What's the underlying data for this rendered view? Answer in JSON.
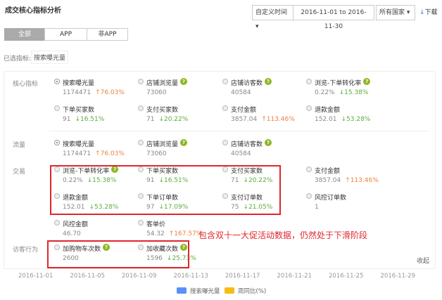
{
  "header": {
    "title": "成交核心指标分析",
    "time_select": "自定义时间",
    "date_range": "2016-11-01 to 2016-11-30",
    "country_select": "所有国家",
    "download": "下载"
  },
  "tabs": [
    {
      "label": "全部",
      "active": true
    },
    {
      "label": "APP"
    },
    {
      "label": "非APP"
    }
  ],
  "selected": {
    "label": "已选指标:",
    "chip": "搜索曝光量"
  },
  "sections": [
    {
      "name": "核心指标",
      "metrics": [
        {
          "label": "搜索曝光量",
          "value": "1174471",
          "change": "↑76.03%",
          "dir": "up",
          "checked": true
        },
        {
          "label": "店铺浏览量",
          "value": "73060",
          "help": true
        },
        {
          "label": "店铺访客数",
          "value": "40584",
          "help": true
        },
        {
          "label": "浏览-下单转化率",
          "value": "0.22%",
          "change": "↓15.38%",
          "dir": "down",
          "help": true
        },
        {
          "label": "下单买家数",
          "value": "91",
          "change": "↓16.51%",
          "dir": "down"
        },
        {
          "label": "支付买家数",
          "value": "71",
          "change": "↓20.22%",
          "dir": "down"
        },
        {
          "label": "支付金额",
          "value": "3857.04",
          "change": "↑113.46%",
          "dir": "up"
        },
        {
          "label": "退款金额",
          "value": "152.01",
          "change": "↓53.28%",
          "dir": "down"
        }
      ]
    },
    {
      "name": "流量",
      "metrics": [
        {
          "label": "搜索曝光量",
          "value": "1174471",
          "change": "↑76.03%",
          "dir": "up",
          "checked": true
        },
        {
          "label": "店铺浏览量",
          "value": "73060",
          "help": true
        },
        {
          "label": "店铺访客数",
          "value": "40584",
          "help": true
        }
      ]
    },
    {
      "name": "交易",
      "metrics": [
        {
          "label": "浏览-下单转化率",
          "value": "0.22%",
          "change": "↓15.38%",
          "dir": "down",
          "help": true
        },
        {
          "label": "下单买家数",
          "value": "91",
          "change": "↓16.51%",
          "dir": "down"
        },
        {
          "label": "支付买家数",
          "value": "71",
          "change": "↓20.22%",
          "dir": "down"
        },
        {
          "label": "支付金额",
          "value": "3857.04",
          "change": "↑113.46%",
          "dir": "up"
        },
        {
          "label": "退款金额",
          "value": "152.01",
          "change": "↓53.28%",
          "dir": "down"
        },
        {
          "label": "下单订单数",
          "value": "97",
          "change": "↓17.09%",
          "dir": "down"
        },
        {
          "label": "支付订单数",
          "value": "75",
          "change": "↓21.05%",
          "dir": "down"
        },
        {
          "label": "风控订单数",
          "value": "1"
        },
        {
          "label": "风控金额",
          "value": "46.70"
        },
        {
          "label": "客单价",
          "value": "54.32",
          "change": "↑167.57%",
          "dir": "up"
        }
      ]
    },
    {
      "name": "访客行为",
      "metrics": [
        {
          "label": "加购物车次数",
          "value": "2600",
          "help": true
        },
        {
          "label": "加收藏次数",
          "value": "1596",
          "change": "↓25.73%",
          "dir": "down",
          "help": true
        }
      ]
    }
  ],
  "annotation": "包含双十一大促活动数据，仍然处于下滑阶段",
  "collapse": "收起",
  "x_ticks": [
    "2016-11-01",
    "2016-11-05",
    "2016-11-09",
    "2016-11-13",
    "2016-11-17",
    "2016-11-21",
    "2016-11-25",
    "2016-11-29"
  ],
  "legend": [
    {
      "label": "搜索曝光量",
      "color": "#5b8ff9"
    },
    {
      "label": "周同比(%)",
      "color": "#f6bd16"
    }
  ],
  "help_glyph": "?",
  "download_icon": "↓"
}
